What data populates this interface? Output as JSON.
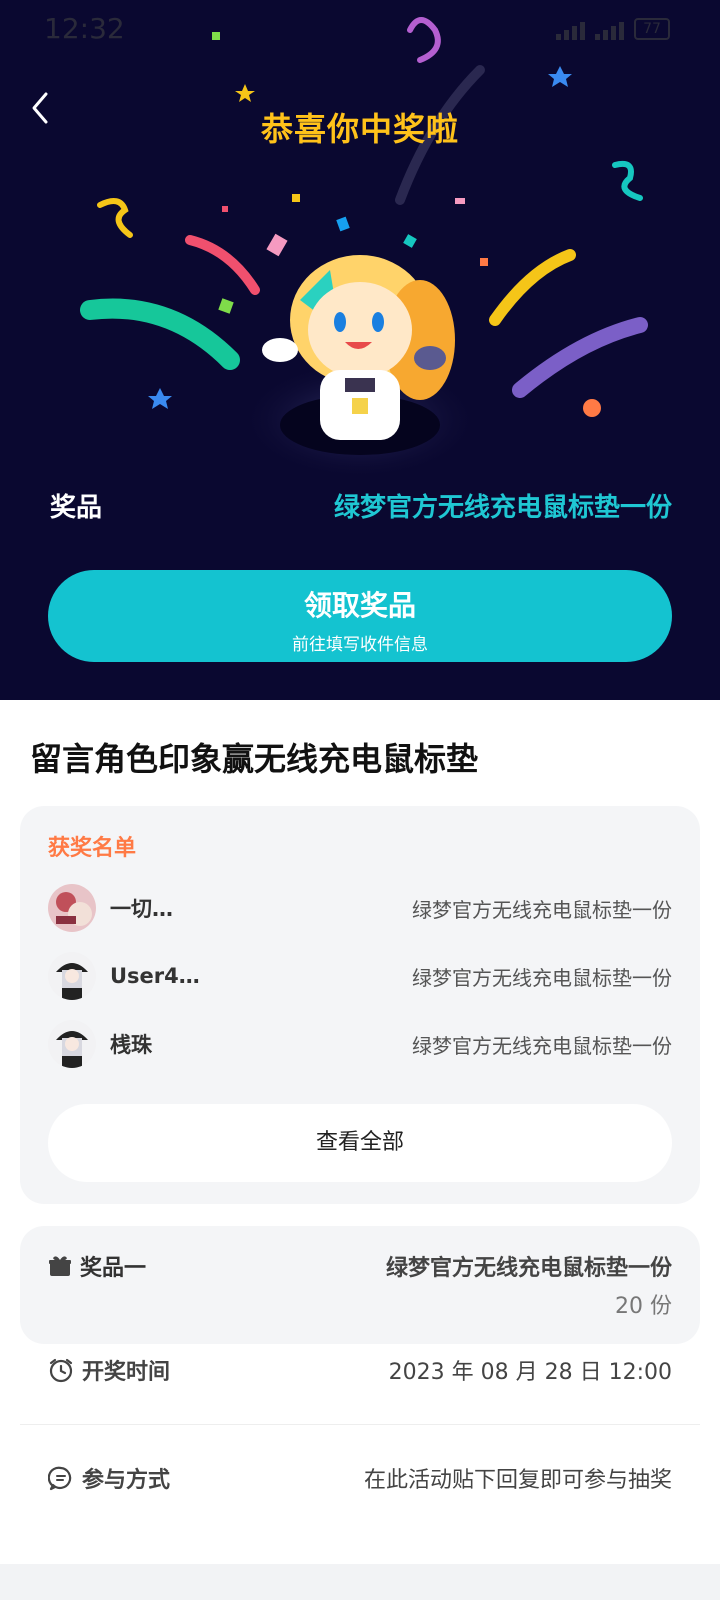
{
  "status": {
    "time": "12:32",
    "battery": "77"
  },
  "header": {
    "title": "恭喜你中奖啦"
  },
  "prize": {
    "label": "奖品",
    "value": "绿梦官方无线充电鼠标垫一份"
  },
  "claim": {
    "main": "领取奖品",
    "sub": "前往填写收件信息"
  },
  "activity": {
    "title": "留言角色印象赢无线充电鼠标垫"
  },
  "winners": {
    "title": "获奖名单",
    "items": [
      {
        "name": "一切…",
        "prize": "绿梦官方无线充电鼠标垫一份"
      },
      {
        "name": "User4…",
        "prize": "绿梦官方无线充电鼠标垫一份"
      },
      {
        "name": "桟珠",
        "prize": "绿梦官方无线充电鼠标垫一份"
      }
    ],
    "view_all": "查看全部"
  },
  "prize_card": {
    "label": "奖品一",
    "name": "绿梦官方无线充电鼠标垫一份",
    "count": "20 份"
  },
  "draw_time": {
    "label": "开奖时间",
    "value": "2023 年 08 月 28 日 12:00"
  },
  "participate": {
    "label": "参与方式",
    "value": "在此活动贴下回复即可参与抽奖"
  },
  "colors": {
    "hero_bg": "#0a0830",
    "accent": "#14c3d0",
    "title_gold": "#ffc21a",
    "winners_title": "#ff7a45"
  }
}
